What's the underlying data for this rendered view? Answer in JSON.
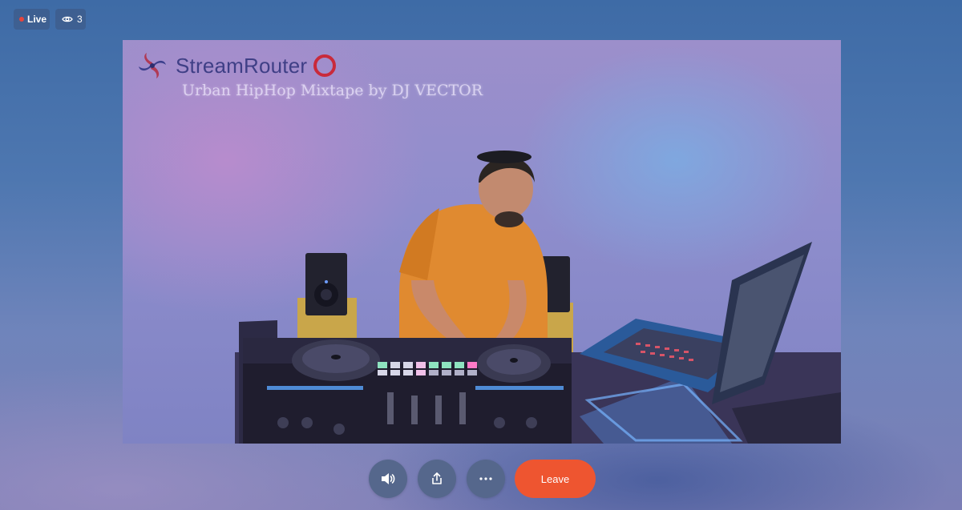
{
  "status": {
    "live_label": "Live",
    "viewer_count": "3",
    "live_dot_color": "#e8453c"
  },
  "stream": {
    "brand_name": "StreamRouter",
    "title": "Urban HipHop Mixtape by DJ VECTOR"
  },
  "controls": {
    "volume_icon": "speaker-icon",
    "share_icon": "share-icon",
    "more_icon": "more-dots-icon",
    "leave_label": "Leave",
    "leave_color": "#ee5530"
  }
}
